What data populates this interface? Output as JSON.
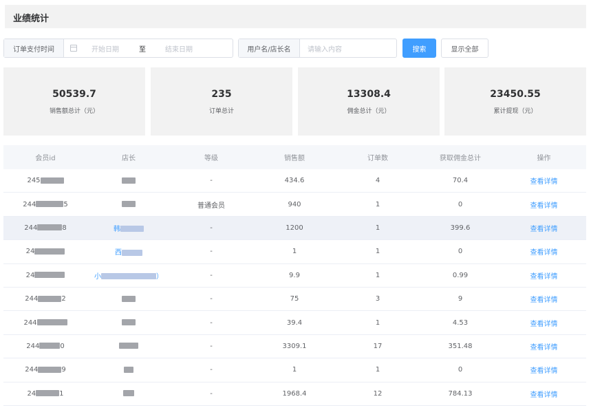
{
  "header": {
    "title": "业绩统计"
  },
  "filters": {
    "date_label": "订单支付时间",
    "date_start_placeholder": "开始日期",
    "date_separator": "至",
    "date_end_placeholder": "结束日期",
    "user_label": "用户名/店长名",
    "user_placeholder": "请输入内容",
    "search_button": "搜索",
    "show_all_button": "显示全部",
    "calendar_icon": "calendar-icon"
  },
  "stats": [
    {
      "value": "50539.7",
      "label": "销售额总计（元）"
    },
    {
      "value": "235",
      "label": "订单总计"
    },
    {
      "value": "13308.4",
      "label": "佣金总计（元）"
    },
    {
      "value": "23450.55",
      "label": "累计提现（元）"
    }
  ],
  "table": {
    "columns": [
      "会员id",
      "店长",
      "等级",
      "销售额",
      "订单数",
      "获取佣金总计",
      "操作"
    ],
    "rows": [
      {
        "id_prefix": "245",
        "id_suffix": "",
        "name_prefix": "",
        "name_suffix": "",
        "level": "-",
        "sales": "434.6",
        "orders": "4",
        "commission": "70.4",
        "action": "查看详情"
      },
      {
        "id_prefix": "244",
        "id_suffix": "5",
        "name_prefix": "",
        "name_suffix": "",
        "level": "普通会员",
        "sales": "940",
        "orders": "1",
        "commission": "0",
        "action": "查看详情"
      },
      {
        "id_prefix": "244",
        "id_suffix": "8",
        "name_prefix": "韩",
        "name_suffix": "",
        "level": "-",
        "sales": "1200",
        "orders": "1",
        "commission": "399.6",
        "action": "查看详情"
      },
      {
        "id_prefix": "24",
        "id_suffix": "",
        "name_prefix": "西",
        "name_suffix": "",
        "level": "-",
        "sales": "1",
        "orders": "1",
        "commission": "0",
        "action": "查看详情"
      },
      {
        "id_prefix": "24",
        "id_suffix": "",
        "name_prefix": "小",
        "name_suffix": "）",
        "level": "-",
        "sales": "9.9",
        "orders": "1",
        "commission": "0.99",
        "action": "查看详情"
      },
      {
        "id_prefix": "244",
        "id_suffix": "2",
        "name_prefix": "",
        "name_suffix": "",
        "level": "-",
        "sales": "75",
        "orders": "3",
        "commission": "9",
        "action": "查看详情"
      },
      {
        "id_prefix": "244",
        "id_suffix": "",
        "name_prefix": "",
        "name_suffix": "",
        "level": "-",
        "sales": "39.4",
        "orders": "1",
        "commission": "4.53",
        "action": "查看详情"
      },
      {
        "id_prefix": "244",
        "id_suffix": "0",
        "name_prefix": "",
        "name_suffix": "",
        "level": "-",
        "sales": "3309.1",
        "orders": "17",
        "commission": "351.48",
        "action": "查看详情"
      },
      {
        "id_prefix": "244",
        "id_suffix": "9",
        "name_prefix": "",
        "name_suffix": "",
        "level": "-",
        "sales": "1",
        "orders": "1",
        "commission": "0",
        "action": "查看详情"
      },
      {
        "id_prefix": "24",
        "id_suffix": "1",
        "name_prefix": "",
        "name_suffix": "",
        "level": "-",
        "sales": "1968.4",
        "orders": "12",
        "commission": "784.13",
        "action": "查看详情"
      }
    ]
  }
}
